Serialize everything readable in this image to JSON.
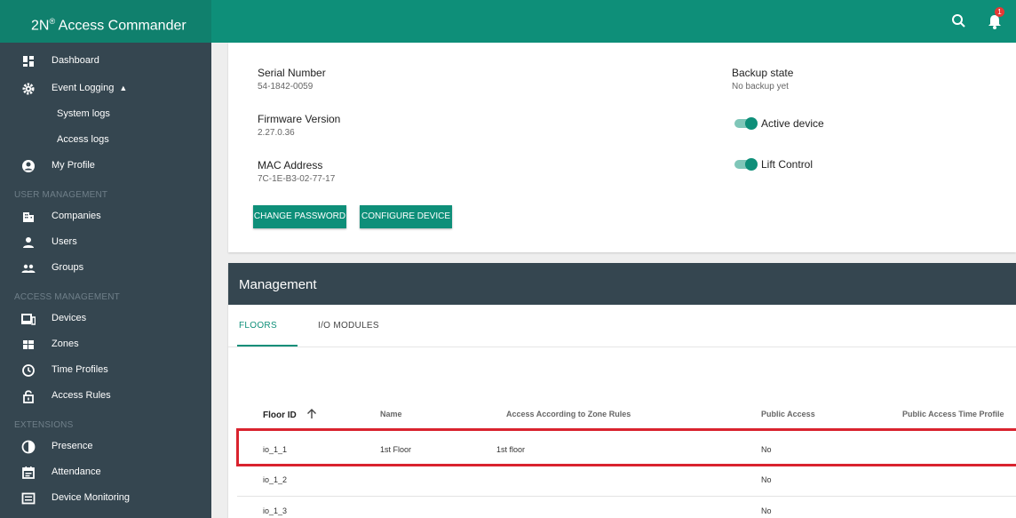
{
  "app": {
    "title_main": "2N",
    "title_sup": "®",
    "title_rest": " Access Commander",
    "notification_count": "1"
  },
  "sidebar": {
    "dashboard": "Dashboard",
    "event_logging": "Event Logging",
    "system_logs": "System logs",
    "access_logs": "Access logs",
    "my_profile": "My Profile",
    "section_user": "USER MANAGEMENT",
    "companies": "Companies",
    "users": "Users",
    "groups": "Groups",
    "section_access": "ACCESS MANAGEMENT",
    "devices": "Devices",
    "zones": "Zones",
    "time_profiles": "Time Profiles",
    "access_rules": "Access Rules",
    "section_ext": "EXTENSIONS",
    "presence": "Presence",
    "attendance": "Attendance",
    "device_monitoring": "Device Monitoring"
  },
  "device": {
    "serial_label": "Serial Number",
    "serial_value": "54-1842-0059",
    "firmware_label": "Firmware Version",
    "firmware_value": "2.27.0.36",
    "mac_label": "MAC Address",
    "mac_value": "7C-1E-B3-02-77-17",
    "backup_label": "Backup state",
    "backup_value": "No backup yet",
    "active_device": "Active device",
    "lift_control": "Lift Control",
    "change_password": "CHANGE PASSWORD",
    "configure_device": "CONFIGURE DEVICE"
  },
  "management": {
    "title": "Management",
    "tabs": [
      "FLOORS",
      "I/O MODULES"
    ],
    "columns": [
      "Floor ID",
      "Name",
      "Access According to Zone Rules",
      "Public Access",
      "Public Access Time Profile"
    ],
    "rows": [
      {
        "floor_id": "io_1_1",
        "name": "1st Floor",
        "zone_rules": "1st floor",
        "public_access": "No"
      },
      {
        "floor_id": "io_1_2",
        "name": "",
        "zone_rules": "",
        "public_access": "No"
      },
      {
        "floor_id": "io_1_3",
        "name": "",
        "zone_rules": "",
        "public_access": "No"
      }
    ]
  },
  "colors": {
    "accent": "#0e8f79",
    "sidebar": "#354650",
    "highlight": "#d9232e"
  }
}
